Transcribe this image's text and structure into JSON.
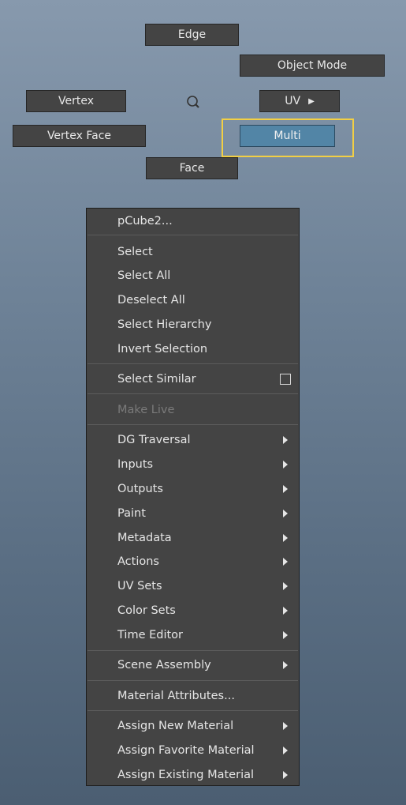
{
  "marking_menu": {
    "edge": "Edge",
    "object_mode": "Object Mode",
    "vertex": "Vertex",
    "uv": "UV",
    "vertex_face": "Vertex Face",
    "multi": "Multi",
    "face": "Face",
    "active_item": "Multi",
    "highlight_color": "#f2cf44",
    "active_color": "#5285a6"
  },
  "context_menu": {
    "header": "pCube2...",
    "items": [
      {
        "label": "Select"
      },
      {
        "label": "Select All"
      },
      {
        "label": "Deselect All"
      },
      {
        "label": "Select Hierarchy"
      },
      {
        "label": "Invert Selection"
      },
      {
        "label": "Select Similar",
        "option_box": true
      },
      {
        "label": "Make Live",
        "disabled": true
      },
      {
        "label": "DG Traversal",
        "submenu": true
      },
      {
        "label": "Inputs",
        "submenu": true
      },
      {
        "label": "Outputs",
        "submenu": true
      },
      {
        "label": "Paint",
        "submenu": true
      },
      {
        "label": "Metadata",
        "submenu": true
      },
      {
        "label": "Actions",
        "submenu": true
      },
      {
        "label": "UV Sets",
        "submenu": true
      },
      {
        "label": "Color Sets",
        "submenu": true
      },
      {
        "label": "Time Editor",
        "submenu": true
      },
      {
        "label": "Scene Assembly",
        "submenu": true
      },
      {
        "label": "Material Attributes..."
      },
      {
        "label": "Assign New Material",
        "submenu": true
      },
      {
        "label": "Assign Favorite Material",
        "submenu": true
      },
      {
        "label": "Assign Existing Material",
        "submenu": true
      }
    ]
  }
}
